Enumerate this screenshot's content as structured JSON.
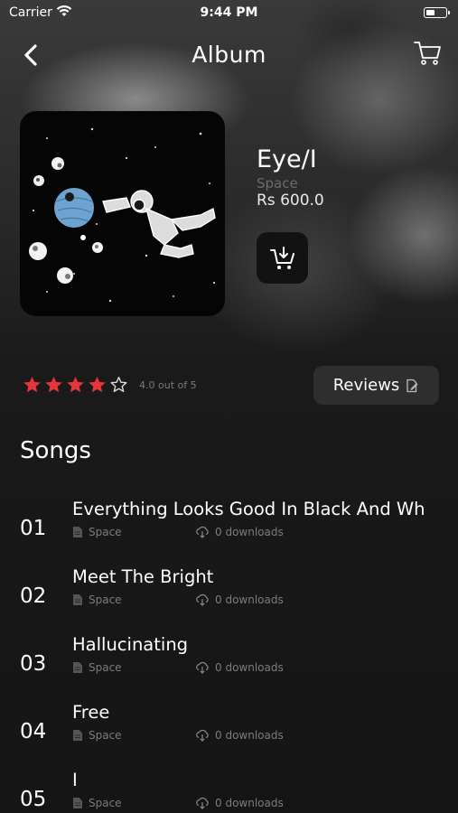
{
  "status_bar": {
    "carrier": "Carrier",
    "time": "9:44 PM"
  },
  "nav": {
    "title": "Album"
  },
  "album": {
    "title": "Eye/I",
    "artist": "Space",
    "price": "Rs 600.0"
  },
  "rating": {
    "value": 4,
    "max": 5,
    "text": "4.0 out of 5"
  },
  "reviews_button": {
    "label": "Reviews"
  },
  "songs_heading": "Songs",
  "songs": [
    {
      "number": "01",
      "title": "Everything Looks Good In Black And Wh",
      "artist": "Space",
      "downloads": "0 downloads"
    },
    {
      "number": "02",
      "title": "Meet The Bright",
      "artist": "Space",
      "downloads": "0 downloads"
    },
    {
      "number": "03",
      "title": "Hallucinating",
      "artist": "Space",
      "downloads": "0 downloads"
    },
    {
      "number": "04",
      "title": "Free",
      "artist": "Space",
      "downloads": "0 downloads"
    },
    {
      "number": "05",
      "title": "I",
      "artist": "Space",
      "downloads": "0 downloads"
    }
  ],
  "colors": {
    "star": "#e8343a",
    "accent": "#ffffff",
    "muted": "#7c7c7c",
    "button_bg": "#2e2e2e"
  },
  "icons": {
    "back": "chevron-left-icon",
    "cart": "cart-icon",
    "add_to_cart": "cart-download-icon",
    "reviews": "edit-icon",
    "song_meta": "document-icon",
    "download": "cloud-download-icon"
  }
}
